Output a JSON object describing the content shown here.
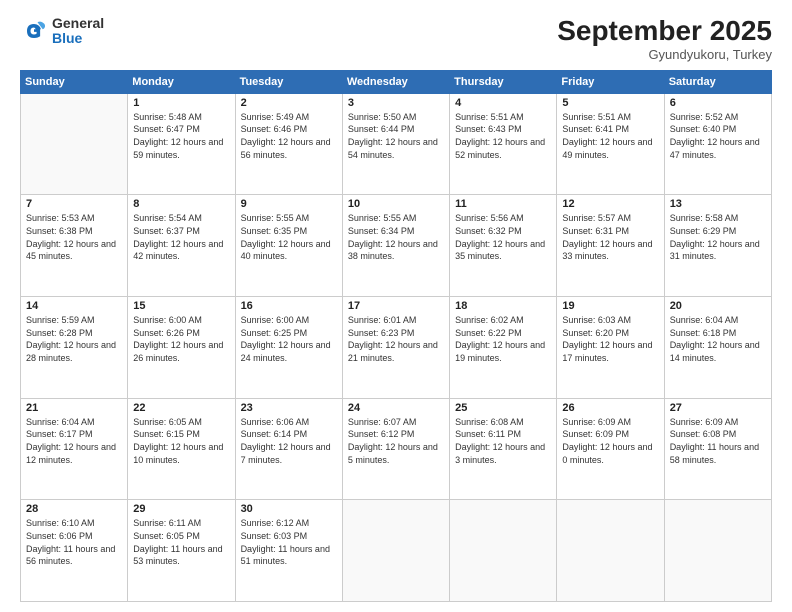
{
  "logo": {
    "general": "General",
    "blue": "Blue"
  },
  "header": {
    "month": "September 2025",
    "location": "Gyundyukoru, Turkey"
  },
  "weekdays": [
    "Sunday",
    "Monday",
    "Tuesday",
    "Wednesday",
    "Thursday",
    "Friday",
    "Saturday"
  ],
  "weeks": [
    [
      {
        "day": "",
        "sunrise": "",
        "sunset": "",
        "daylight": ""
      },
      {
        "day": "1",
        "sunrise": "Sunrise: 5:48 AM",
        "sunset": "Sunset: 6:47 PM",
        "daylight": "Daylight: 12 hours and 59 minutes."
      },
      {
        "day": "2",
        "sunrise": "Sunrise: 5:49 AM",
        "sunset": "Sunset: 6:46 PM",
        "daylight": "Daylight: 12 hours and 56 minutes."
      },
      {
        "day": "3",
        "sunrise": "Sunrise: 5:50 AM",
        "sunset": "Sunset: 6:44 PM",
        "daylight": "Daylight: 12 hours and 54 minutes."
      },
      {
        "day": "4",
        "sunrise": "Sunrise: 5:51 AM",
        "sunset": "Sunset: 6:43 PM",
        "daylight": "Daylight: 12 hours and 52 minutes."
      },
      {
        "day": "5",
        "sunrise": "Sunrise: 5:51 AM",
        "sunset": "Sunset: 6:41 PM",
        "daylight": "Daylight: 12 hours and 49 minutes."
      },
      {
        "day": "6",
        "sunrise": "Sunrise: 5:52 AM",
        "sunset": "Sunset: 6:40 PM",
        "daylight": "Daylight: 12 hours and 47 minutes."
      }
    ],
    [
      {
        "day": "7",
        "sunrise": "Sunrise: 5:53 AM",
        "sunset": "Sunset: 6:38 PM",
        "daylight": "Daylight: 12 hours and 45 minutes."
      },
      {
        "day": "8",
        "sunrise": "Sunrise: 5:54 AM",
        "sunset": "Sunset: 6:37 PM",
        "daylight": "Daylight: 12 hours and 42 minutes."
      },
      {
        "day": "9",
        "sunrise": "Sunrise: 5:55 AM",
        "sunset": "Sunset: 6:35 PM",
        "daylight": "Daylight: 12 hours and 40 minutes."
      },
      {
        "day": "10",
        "sunrise": "Sunrise: 5:55 AM",
        "sunset": "Sunset: 6:34 PM",
        "daylight": "Daylight: 12 hours and 38 minutes."
      },
      {
        "day": "11",
        "sunrise": "Sunrise: 5:56 AM",
        "sunset": "Sunset: 6:32 PM",
        "daylight": "Daylight: 12 hours and 35 minutes."
      },
      {
        "day": "12",
        "sunrise": "Sunrise: 5:57 AM",
        "sunset": "Sunset: 6:31 PM",
        "daylight": "Daylight: 12 hours and 33 minutes."
      },
      {
        "day": "13",
        "sunrise": "Sunrise: 5:58 AM",
        "sunset": "Sunset: 6:29 PM",
        "daylight": "Daylight: 12 hours and 31 minutes."
      }
    ],
    [
      {
        "day": "14",
        "sunrise": "Sunrise: 5:59 AM",
        "sunset": "Sunset: 6:28 PM",
        "daylight": "Daylight: 12 hours and 28 minutes."
      },
      {
        "day": "15",
        "sunrise": "Sunrise: 6:00 AM",
        "sunset": "Sunset: 6:26 PM",
        "daylight": "Daylight: 12 hours and 26 minutes."
      },
      {
        "day": "16",
        "sunrise": "Sunrise: 6:00 AM",
        "sunset": "Sunset: 6:25 PM",
        "daylight": "Daylight: 12 hours and 24 minutes."
      },
      {
        "day": "17",
        "sunrise": "Sunrise: 6:01 AM",
        "sunset": "Sunset: 6:23 PM",
        "daylight": "Daylight: 12 hours and 21 minutes."
      },
      {
        "day": "18",
        "sunrise": "Sunrise: 6:02 AM",
        "sunset": "Sunset: 6:22 PM",
        "daylight": "Daylight: 12 hours and 19 minutes."
      },
      {
        "day": "19",
        "sunrise": "Sunrise: 6:03 AM",
        "sunset": "Sunset: 6:20 PM",
        "daylight": "Daylight: 12 hours and 17 minutes."
      },
      {
        "day": "20",
        "sunrise": "Sunrise: 6:04 AM",
        "sunset": "Sunset: 6:18 PM",
        "daylight": "Daylight: 12 hours and 14 minutes."
      }
    ],
    [
      {
        "day": "21",
        "sunrise": "Sunrise: 6:04 AM",
        "sunset": "Sunset: 6:17 PM",
        "daylight": "Daylight: 12 hours and 12 minutes."
      },
      {
        "day": "22",
        "sunrise": "Sunrise: 6:05 AM",
        "sunset": "Sunset: 6:15 PM",
        "daylight": "Daylight: 12 hours and 10 minutes."
      },
      {
        "day": "23",
        "sunrise": "Sunrise: 6:06 AM",
        "sunset": "Sunset: 6:14 PM",
        "daylight": "Daylight: 12 hours and 7 minutes."
      },
      {
        "day": "24",
        "sunrise": "Sunrise: 6:07 AM",
        "sunset": "Sunset: 6:12 PM",
        "daylight": "Daylight: 12 hours and 5 minutes."
      },
      {
        "day": "25",
        "sunrise": "Sunrise: 6:08 AM",
        "sunset": "Sunset: 6:11 PM",
        "daylight": "Daylight: 12 hours and 3 minutes."
      },
      {
        "day": "26",
        "sunrise": "Sunrise: 6:09 AM",
        "sunset": "Sunset: 6:09 PM",
        "daylight": "Daylight: 12 hours and 0 minutes."
      },
      {
        "day": "27",
        "sunrise": "Sunrise: 6:09 AM",
        "sunset": "Sunset: 6:08 PM",
        "daylight": "Daylight: 11 hours and 58 minutes."
      }
    ],
    [
      {
        "day": "28",
        "sunrise": "Sunrise: 6:10 AM",
        "sunset": "Sunset: 6:06 PM",
        "daylight": "Daylight: 11 hours and 56 minutes."
      },
      {
        "day": "29",
        "sunrise": "Sunrise: 6:11 AM",
        "sunset": "Sunset: 6:05 PM",
        "daylight": "Daylight: 11 hours and 53 minutes."
      },
      {
        "day": "30",
        "sunrise": "Sunrise: 6:12 AM",
        "sunset": "Sunset: 6:03 PM",
        "daylight": "Daylight: 11 hours and 51 minutes."
      },
      {
        "day": "",
        "sunrise": "",
        "sunset": "",
        "daylight": ""
      },
      {
        "day": "",
        "sunrise": "",
        "sunset": "",
        "daylight": ""
      },
      {
        "day": "",
        "sunrise": "",
        "sunset": "",
        "daylight": ""
      },
      {
        "day": "",
        "sunrise": "",
        "sunset": "",
        "daylight": ""
      }
    ]
  ]
}
